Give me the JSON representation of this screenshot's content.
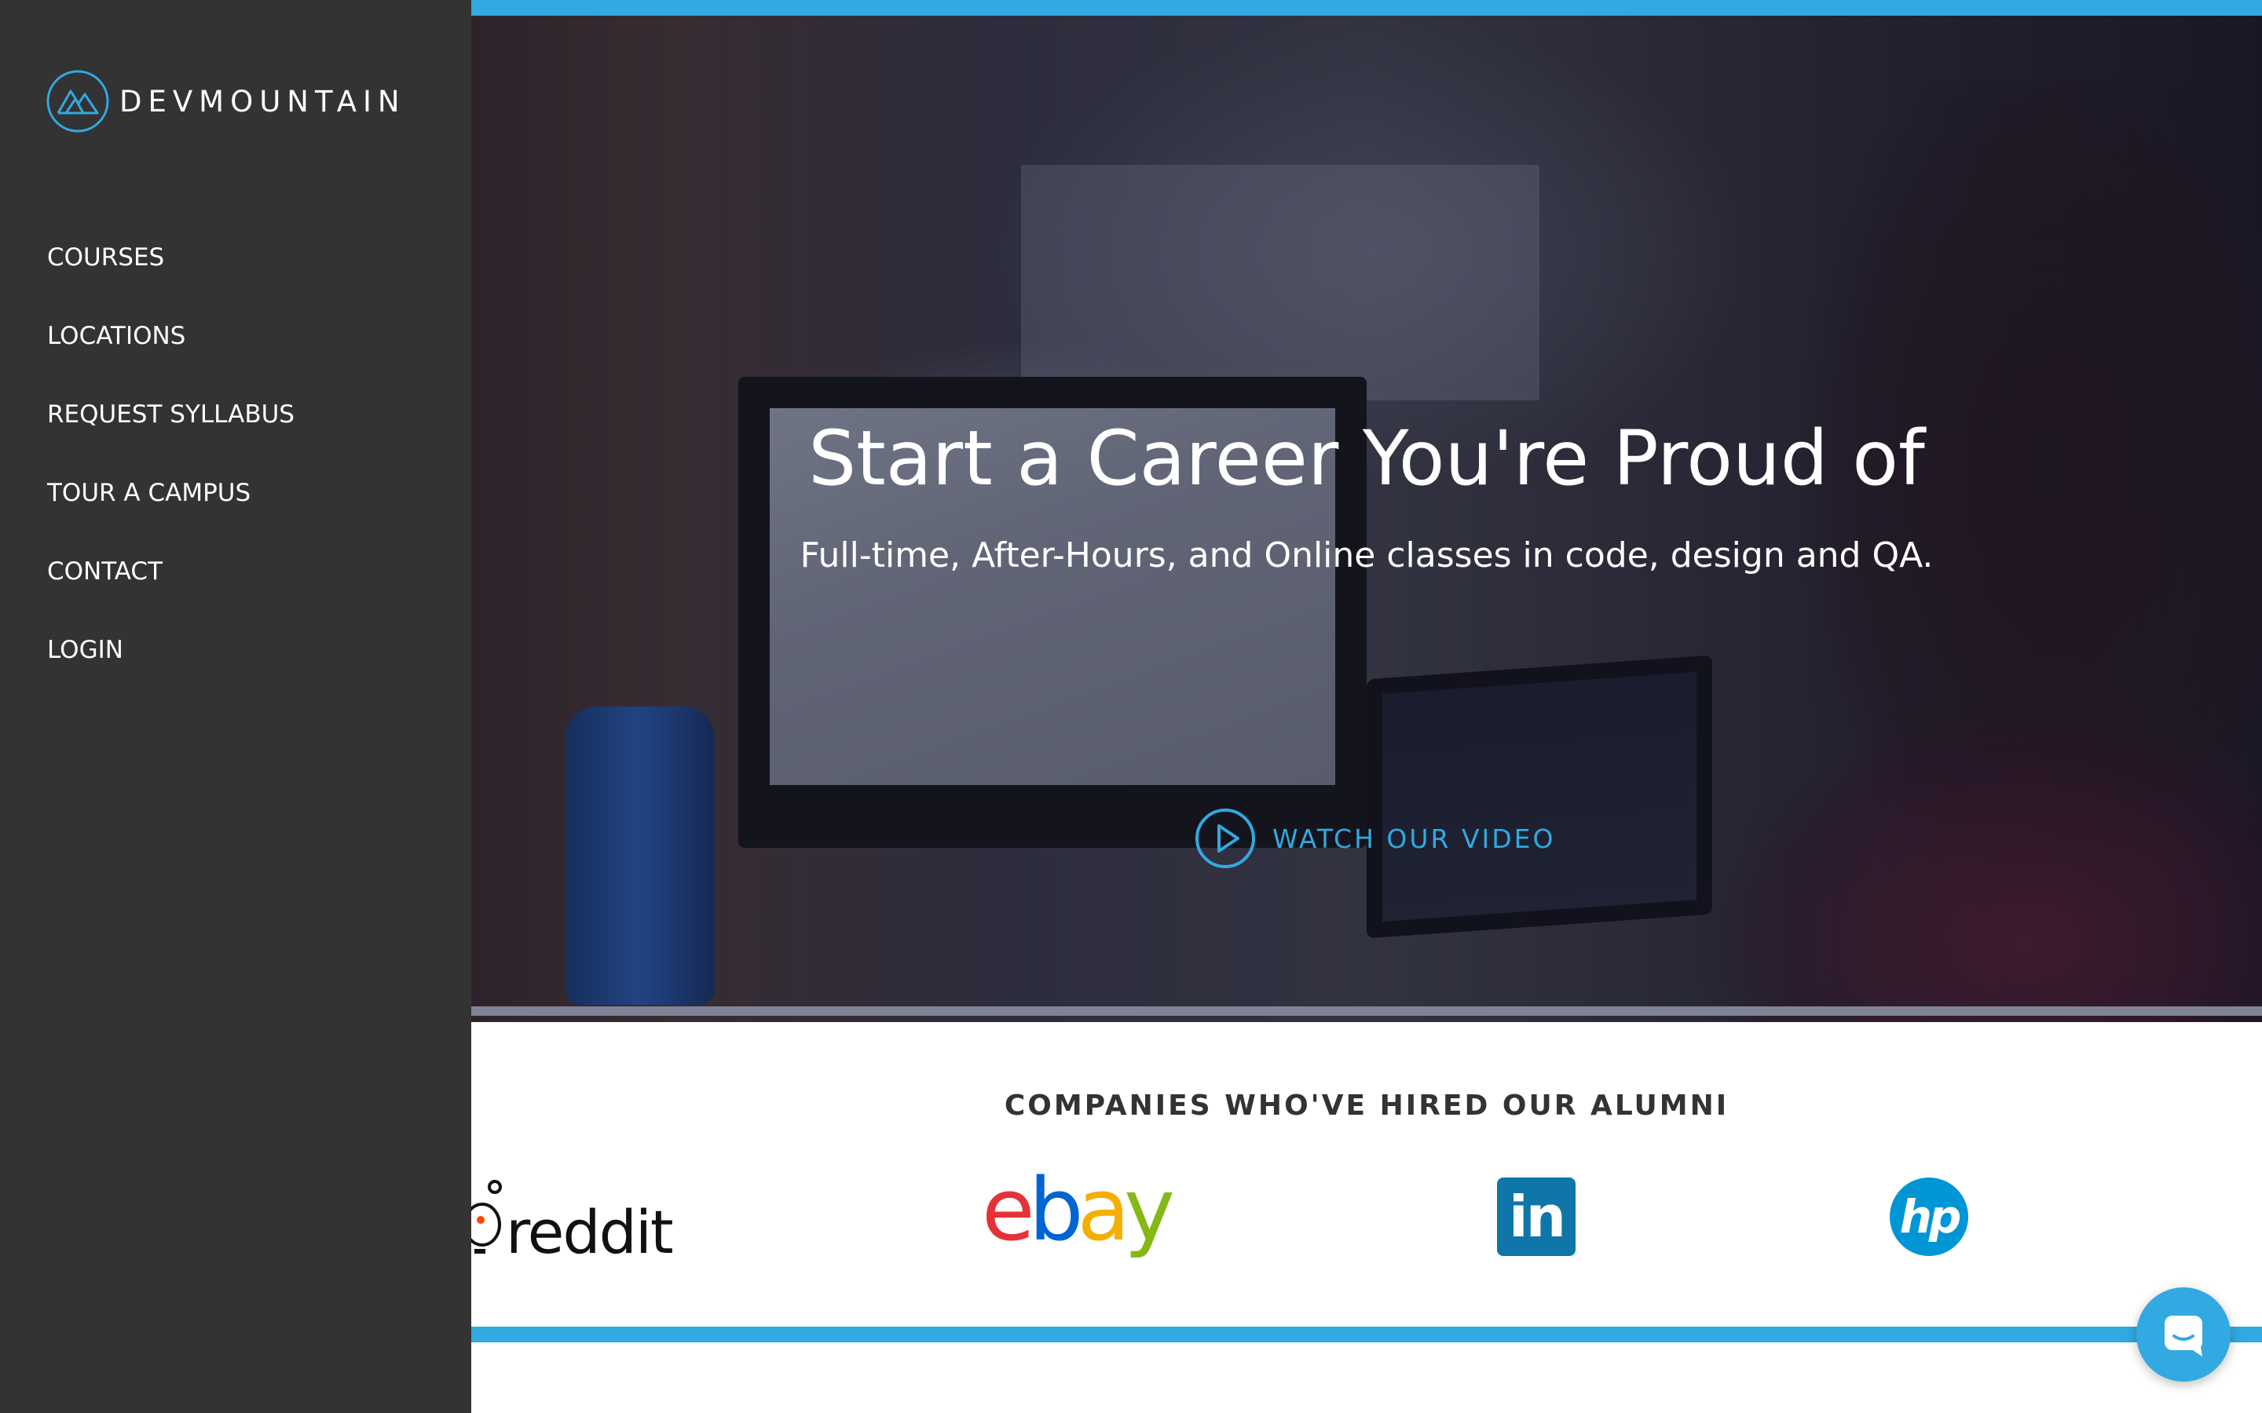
{
  "brand": {
    "name": "DEVMOUNTAIN",
    "logo_icon": "mountain-circle-icon",
    "accent_color": "#32a9e0"
  },
  "sidebar": {
    "items": [
      {
        "label": "COURSES"
      },
      {
        "label": "LOCATIONS"
      },
      {
        "label": "REQUEST SYLLABUS"
      },
      {
        "label": "TOUR A CAMPUS"
      },
      {
        "label": "CONTACT"
      },
      {
        "label": "LOGIN"
      }
    ],
    "background_color": "#333333"
  },
  "hero": {
    "title": "Start a Career You're Proud of",
    "subtitle": "Full-time, After-Hours, and Online classes in code, design and QA.",
    "cta_label": "WATCH OUR VIDEO",
    "cta_icon": "play-circle-icon"
  },
  "companies": {
    "title": "COMPANIES WHO'VE HIRED OUR ALUMNI",
    "logos": [
      {
        "name": "reddit",
        "text": "reddit",
        "icon": "reddit-alien-icon"
      },
      {
        "name": "ebay",
        "letters": [
          {
            "char": "e",
            "color": "#e53238"
          },
          {
            "char": "b",
            "color": "#0064d2"
          },
          {
            "char": "a",
            "color": "#f5af02"
          },
          {
            "char": "y",
            "color": "#86b817"
          }
        ]
      },
      {
        "name": "linkedin",
        "text": "in",
        "color": "#0e76a8"
      },
      {
        "name": "hp",
        "text": "hp",
        "color": "#0096d6"
      }
    ]
  },
  "chat": {
    "icon": "chat-bubble-icon"
  }
}
